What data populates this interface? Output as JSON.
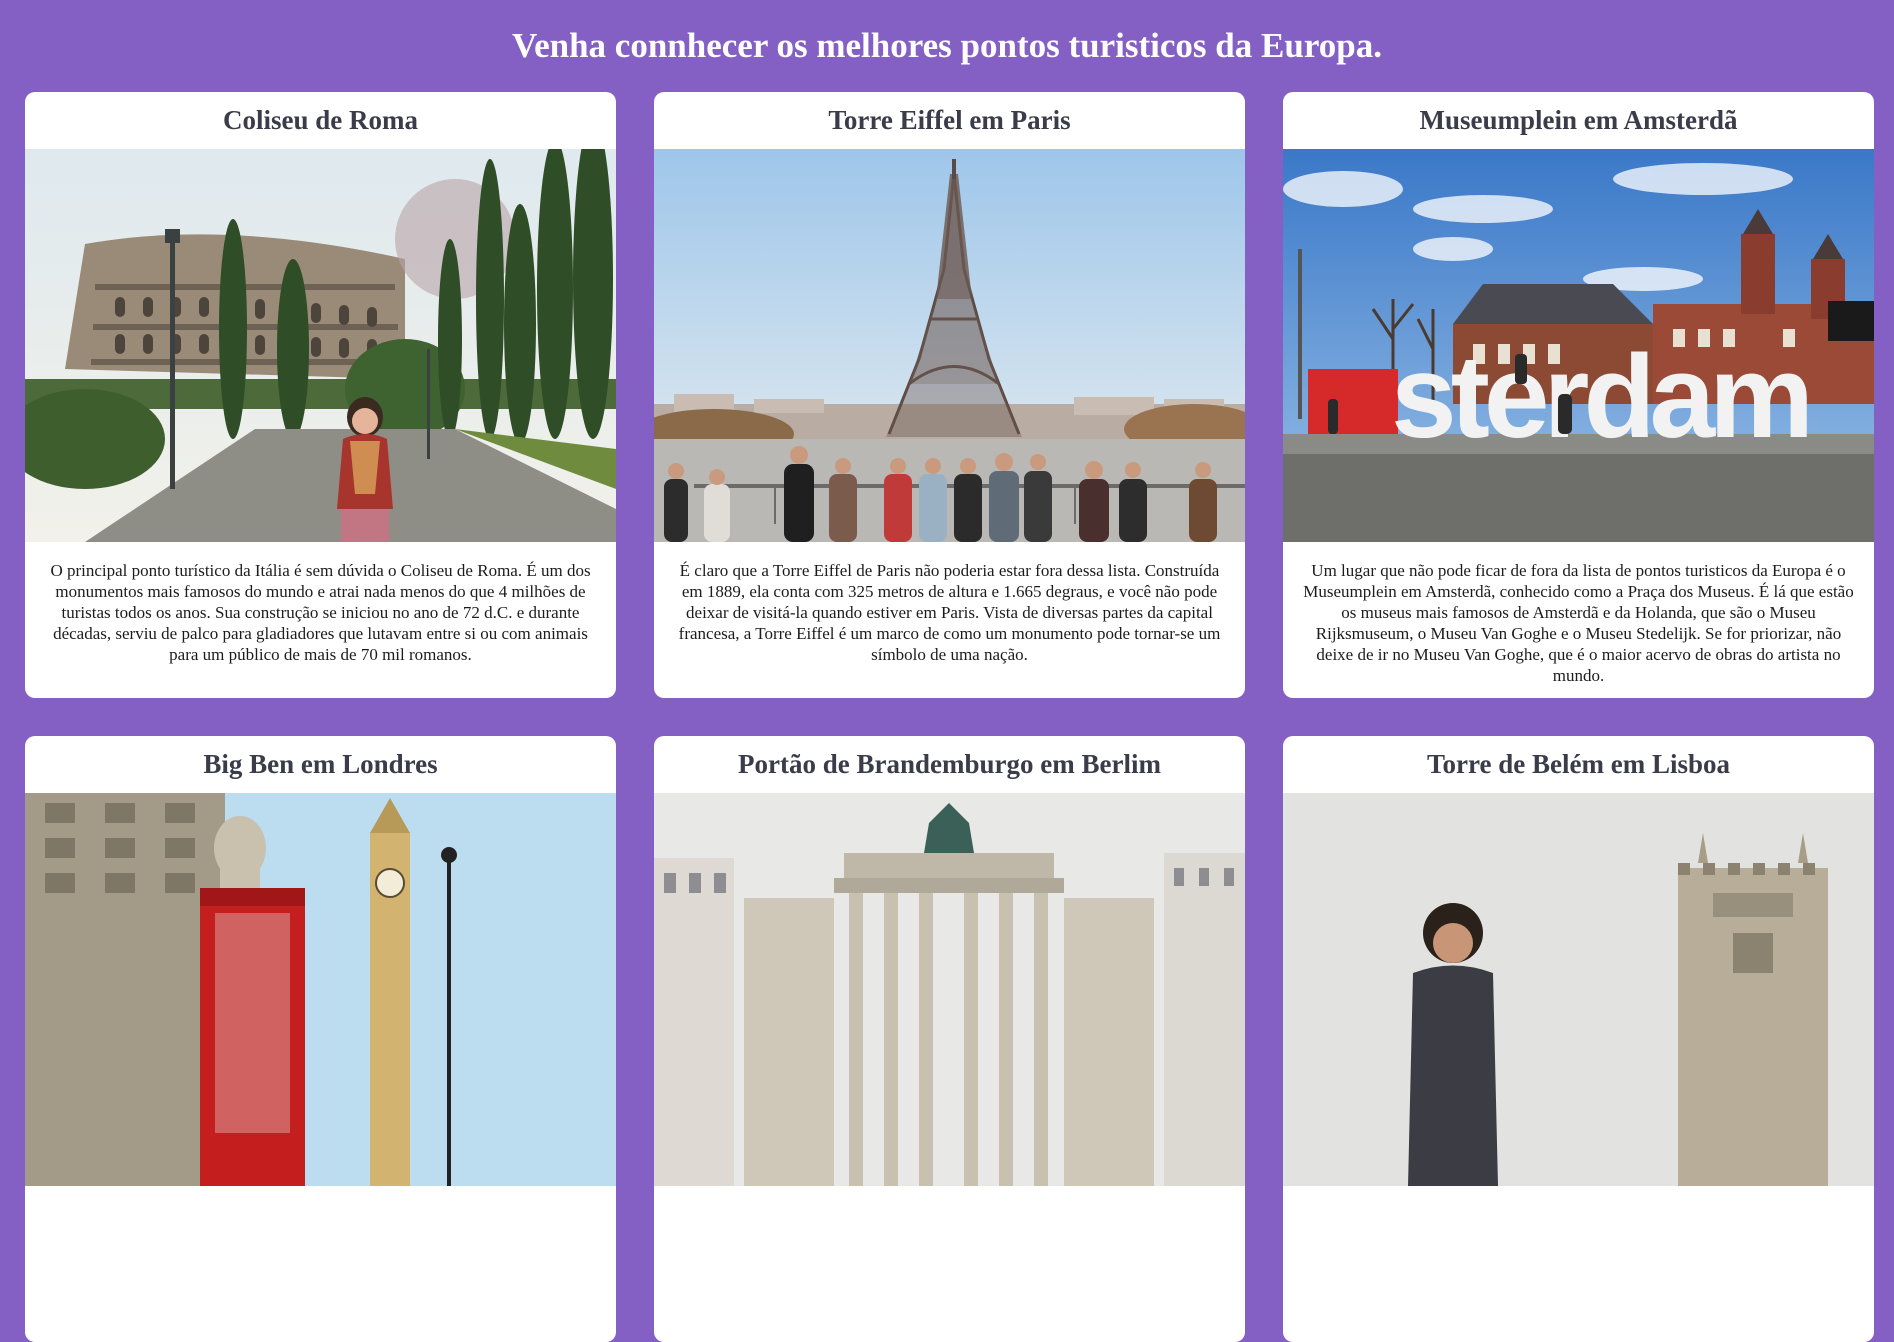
{
  "page": {
    "title": "Venha connhecer os melhores pontos turisticos da Europa."
  },
  "cards": [
    {
      "title": "Coliseu de Roma",
      "image": "colosseum-photo",
      "text": "O principal ponto turístico da Itália é sem dúvida o Coliseu de Roma. É um dos monumentos mais famosos do mundo e atrai nada menos do que 4 milhões de turistas todos os anos. Sua construção se iniciou no ano de 72 d.C. e durante décadas, serviu de palco para gladiadores que lutavam entre si ou com animais para um público de mais de 70 mil romanos."
    },
    {
      "title": "Torre Eiffel em Paris",
      "image": "eiffel-tower-photo",
      "text": "É claro que a Torre Eiffel de Paris não poderia estar fora dessa lista. Construída em 1889, ela conta com 325 metros de altura e 1.665 degraus, e você não pode deixar de visitá-la quando estiver em Paris. Vista de diversas partes da capital francesa, a Torre Eiffel é um marco de como um monumento pode tornar-se um símbolo de uma nação."
    },
    {
      "title": "Museumplein em Amsterdã",
      "image": "museumplein-photo",
      "sign_text": "I amsterdam",
      "text": "Um lugar que não pode ficar de fora da lista de pontos turisticos da Europa é o Museumplein em Amsterdã, conhecido como a Praça dos Museus. É lá que estão os museus mais famosos de Amsterdã e da Holanda, que são o Museu Rijksmuseum, o Museu Van Goghe e o Museu Stedelijk. Se for priorizar, não deixe de ir no Museu Van Goghe, que é o maior acervo de obras do artista no mundo."
    },
    {
      "title": "Big Ben em Londres",
      "image": "big-ben-photo",
      "text": ""
    },
    {
      "title": "Portão de Brandemburgo em Berlim",
      "image": "brandenburg-gate-photo",
      "text": ""
    },
    {
      "title": "Torre de Belém em Lisboa",
      "image": "belem-tower-photo",
      "text": ""
    }
  ],
  "colors": {
    "background": "#8560c4",
    "card": "#ffffff",
    "card_title": "#3b3b4a"
  }
}
